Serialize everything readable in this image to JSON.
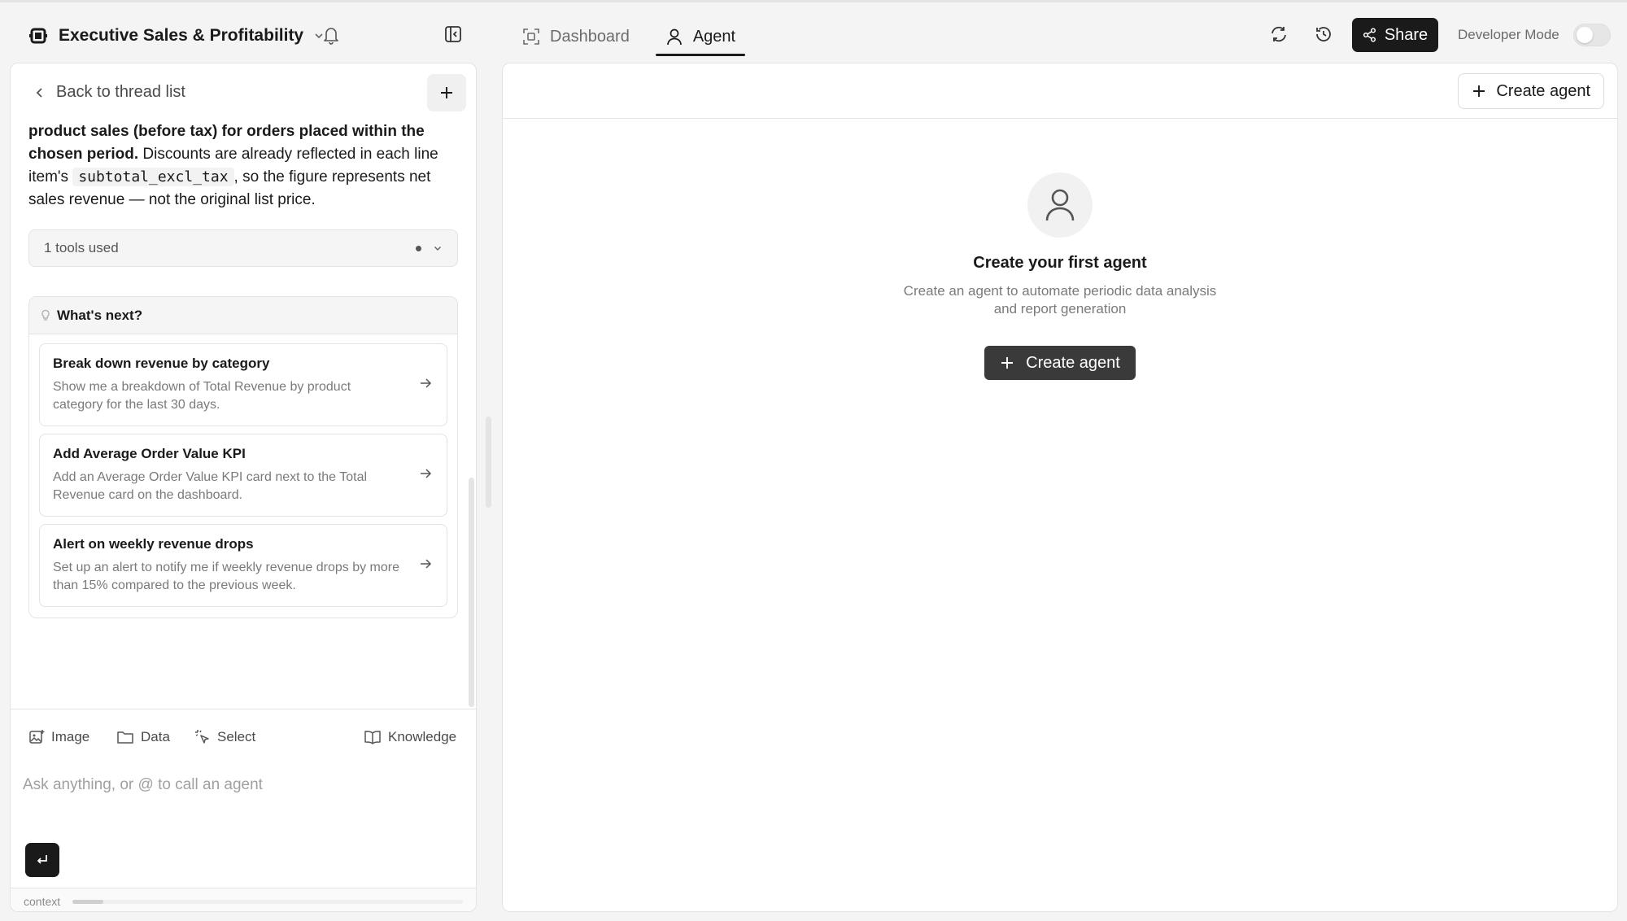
{
  "header": {
    "title": "Executive Sales & Profitability",
    "tabs": [
      {
        "label": "Dashboard",
        "active": false
      },
      {
        "label": "Agent",
        "active": true
      }
    ],
    "share_label": "Share",
    "developer_mode_label": "Developer Mode",
    "developer_mode_on": false
  },
  "thread": {
    "back_label": "Back to thread list",
    "message": {
      "bold_part": "product sales (before tax) for orders placed within the chosen period.",
      "text_part1": " Discounts are already reflected in each line item's ",
      "code": "subtotal_excl_tax",
      "text_part2": ", so the figure represents net sales revenue — not the original list price."
    },
    "tools_used_label": "1 tools used",
    "whats_next": {
      "title": "What's next?",
      "suggestions": [
        {
          "title": "Break down revenue by category",
          "desc": "Show me a breakdown of Total Revenue by product category for the last 30 days."
        },
        {
          "title": "Add Average Order Value KPI",
          "desc": "Add an Average Order Value KPI card next to the Total Revenue card on the dashboard."
        },
        {
          "title": "Alert on weekly revenue drops",
          "desc": "Set up an alert to notify me if weekly revenue drops by more than 15% compared to the previous week."
        }
      ]
    }
  },
  "composer": {
    "toolbar": {
      "image": "Image",
      "data": "Data",
      "select": "Select",
      "knowledge": "Knowledge"
    },
    "placeholder": "Ask anything, or @ to call an agent",
    "context_label": "context",
    "context_usage": 0.08
  },
  "agent_panel": {
    "create_button_label": "Create agent",
    "empty_title": "Create your first agent",
    "empty_desc": "Create an agent to automate periodic data analysis and report generation",
    "empty_button_label": "Create agent"
  },
  "icons": {
    "brand": "app-logo-icon",
    "bell": "bell-icon",
    "collapse": "sidebar-collapse-icon",
    "dashboard": "dashboard-icon",
    "agent": "user-icon",
    "refresh": "refresh-icon",
    "history": "history-icon",
    "share": "share-icon"
  }
}
